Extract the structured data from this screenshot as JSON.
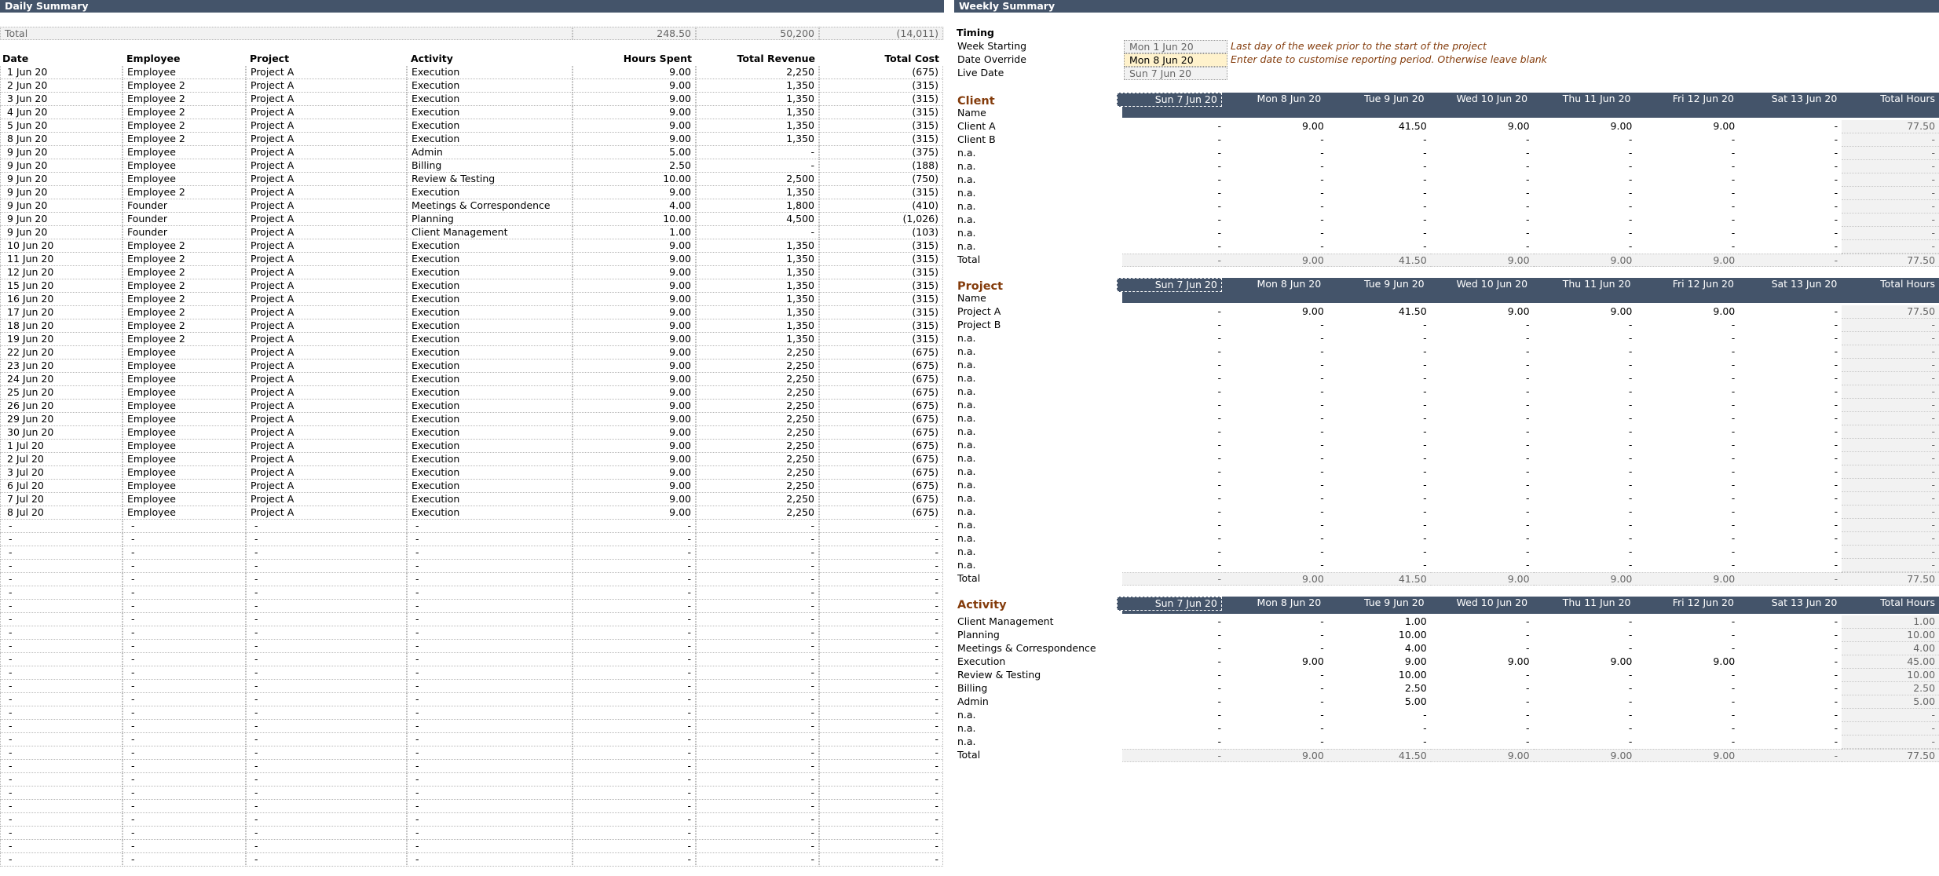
{
  "daily": {
    "title": "Daily Summary",
    "total": {
      "label": "Total",
      "hours": "248.50",
      "revenue": "50,200",
      "cost": "(14,011)"
    },
    "headers": [
      "Date",
      "Employee",
      "Project",
      "Activity",
      "Hours Spent",
      "Total Revenue",
      "Total Cost"
    ],
    "rows": [
      [
        "1 Jun 20",
        "Employee",
        "Project A",
        "Execution",
        "9.00",
        "2,250",
        "(675)"
      ],
      [
        "2 Jun 20",
        "Employee 2",
        "Project A",
        "Execution",
        "9.00",
        "1,350",
        "(315)"
      ],
      [
        "3 Jun 20",
        "Employee 2",
        "Project A",
        "Execution",
        "9.00",
        "1,350",
        "(315)"
      ],
      [
        "4 Jun 20",
        "Employee 2",
        "Project A",
        "Execution",
        "9.00",
        "1,350",
        "(315)"
      ],
      [
        "5 Jun 20",
        "Employee 2",
        "Project A",
        "Execution",
        "9.00",
        "1,350",
        "(315)"
      ],
      [
        "8 Jun 20",
        "Employee 2",
        "Project A",
        "Execution",
        "9.00",
        "1,350",
        "(315)"
      ],
      [
        "9 Jun 20",
        "Employee",
        "Project A",
        "Admin",
        "5.00",
        "-",
        "(375)"
      ],
      [
        "9 Jun 20",
        "Employee",
        "Project A",
        "Billing",
        "2.50",
        "-",
        "(188)"
      ],
      [
        "9 Jun 20",
        "Employee",
        "Project A",
        "Review & Testing",
        "10.00",
        "2,500",
        "(750)"
      ],
      [
        "9 Jun 20",
        "Employee 2",
        "Project A",
        "Execution",
        "9.00",
        "1,350",
        "(315)"
      ],
      [
        "9 Jun 20",
        "Founder",
        "Project A",
        "Meetings & Correspondence",
        "4.00",
        "1,800",
        "(410)"
      ],
      [
        "9 Jun 20",
        "Founder",
        "Project A",
        "Planning",
        "10.00",
        "4,500",
        "(1,026)"
      ],
      [
        "9 Jun 20",
        "Founder",
        "Project A",
        "Client Management",
        "1.00",
        "-",
        "(103)"
      ],
      [
        "10 Jun 20",
        "Employee 2",
        "Project A",
        "Execution",
        "9.00",
        "1,350",
        "(315)"
      ],
      [
        "11 Jun 20",
        "Employee 2",
        "Project A",
        "Execution",
        "9.00",
        "1,350",
        "(315)"
      ],
      [
        "12 Jun 20",
        "Employee 2",
        "Project A",
        "Execution",
        "9.00",
        "1,350",
        "(315)"
      ],
      [
        "15 Jun 20",
        "Employee 2",
        "Project A",
        "Execution",
        "9.00",
        "1,350",
        "(315)"
      ],
      [
        "16 Jun 20",
        "Employee 2",
        "Project A",
        "Execution",
        "9.00",
        "1,350",
        "(315)"
      ],
      [
        "17 Jun 20",
        "Employee 2",
        "Project A",
        "Execution",
        "9.00",
        "1,350",
        "(315)"
      ],
      [
        "18 Jun 20",
        "Employee 2",
        "Project A",
        "Execution",
        "9.00",
        "1,350",
        "(315)"
      ],
      [
        "19 Jun 20",
        "Employee 2",
        "Project A",
        "Execution",
        "9.00",
        "1,350",
        "(315)"
      ],
      [
        "22 Jun 20",
        "Employee",
        "Project A",
        "Execution",
        "9.00",
        "2,250",
        "(675)"
      ],
      [
        "23 Jun 20",
        "Employee",
        "Project A",
        "Execution",
        "9.00",
        "2,250",
        "(675)"
      ],
      [
        "24 Jun 20",
        "Employee",
        "Project A",
        "Execution",
        "9.00",
        "2,250",
        "(675)"
      ],
      [
        "25 Jun 20",
        "Employee",
        "Project A",
        "Execution",
        "9.00",
        "2,250",
        "(675)"
      ],
      [
        "26 Jun 20",
        "Employee",
        "Project A",
        "Execution",
        "9.00",
        "2,250",
        "(675)"
      ],
      [
        "29 Jun 20",
        "Employee",
        "Project A",
        "Execution",
        "9.00",
        "2,250",
        "(675)"
      ],
      [
        "30 Jun 20",
        "Employee",
        "Project A",
        "Execution",
        "9.00",
        "2,250",
        "(675)"
      ],
      [
        "1 Jul 20",
        "Employee",
        "Project A",
        "Execution",
        "9.00",
        "2,250",
        "(675)"
      ],
      [
        "2 Jul 20",
        "Employee",
        "Project A",
        "Execution",
        "9.00",
        "2,250",
        "(675)"
      ],
      [
        "3 Jul 20",
        "Employee",
        "Project A",
        "Execution",
        "9.00",
        "2,250",
        "(675)"
      ],
      [
        "6 Jul 20",
        "Employee",
        "Project A",
        "Execution",
        "9.00",
        "2,250",
        "(675)"
      ],
      [
        "7 Jul 20",
        "Employee",
        "Project A",
        "Execution",
        "9.00",
        "2,250",
        "(675)"
      ],
      [
        "8 Jul 20",
        "Employee",
        "Project A",
        "Execution",
        "9.00",
        "2,250",
        "(675)"
      ]
    ],
    "blank_row": [
      "-",
      "-",
      "-",
      "-",
      "-",
      "-",
      "-"
    ],
    "blank_count": 26
  },
  "weekly": {
    "title": "Weekly Summary",
    "timing": {
      "heading": "Timing",
      "fields": [
        {
          "label": "Week Starting",
          "value": "Mon 1 Jun 20",
          "note": "Last day of the week prior to the start of the project",
          "style": "grey"
        },
        {
          "label": "Date Override",
          "value": "Mon 8 Jun 20",
          "note": "Enter date to customise reporting period. Otherwise leave blank",
          "style": "yellow"
        },
        {
          "label": "Live Date",
          "value": "Sun 7 Jun 20",
          "note": "",
          "style": "grey"
        }
      ]
    },
    "day_headers": [
      "Sun 7 Jun 20",
      "Mon 8 Jun 20",
      "Tue 9 Jun 20",
      "Wed 10 Jun 20",
      "Thu 11 Jun 20",
      "Fri 12 Jun 20",
      "Sat 13 Jun 20",
      "Total Hours"
    ],
    "sections": [
      {
        "title": "Client",
        "sub_label": "Name",
        "rows": [
          [
            "Client A",
            "-",
            "9.00",
            "41.50",
            "9.00",
            "9.00",
            "9.00",
            "-",
            "77.50"
          ],
          [
            "Client B",
            "-",
            "-",
            "-",
            "-",
            "-",
            "-",
            "-",
            "-"
          ],
          [
            "n.a.",
            "-",
            "-",
            "-",
            "-",
            "-",
            "-",
            "-",
            "-"
          ],
          [
            "n.a.",
            "-",
            "-",
            "-",
            "-",
            "-",
            "-",
            "-",
            "-"
          ],
          [
            "n.a.",
            "-",
            "-",
            "-",
            "-",
            "-",
            "-",
            "-",
            "-"
          ],
          [
            "n.a.",
            "-",
            "-",
            "-",
            "-",
            "-",
            "-",
            "-",
            "-"
          ],
          [
            "n.a.",
            "-",
            "-",
            "-",
            "-",
            "-",
            "-",
            "-",
            "-"
          ],
          [
            "n.a.",
            "-",
            "-",
            "-",
            "-",
            "-",
            "-",
            "-",
            "-"
          ],
          [
            "n.a.",
            "-",
            "-",
            "-",
            "-",
            "-",
            "-",
            "-",
            "-"
          ],
          [
            "n.a.",
            "-",
            "-",
            "-",
            "-",
            "-",
            "-",
            "-",
            "-"
          ]
        ],
        "total": [
          "Total",
          "-",
          "9.00",
          "41.50",
          "9.00",
          "9.00",
          "9.00",
          "-",
          "77.50"
        ]
      },
      {
        "title": "Project",
        "sub_label": "Name",
        "rows": [
          [
            "Project A",
            "-",
            "9.00",
            "41.50",
            "9.00",
            "9.00",
            "9.00",
            "-",
            "77.50"
          ],
          [
            "Project B",
            "-",
            "-",
            "-",
            "-",
            "-",
            "-",
            "-",
            "-"
          ],
          [
            "n.a.",
            "-",
            "-",
            "-",
            "-",
            "-",
            "-",
            "-",
            "-"
          ],
          [
            "n.a.",
            "-",
            "-",
            "-",
            "-",
            "-",
            "-",
            "-",
            "-"
          ],
          [
            "n.a.",
            "-",
            "-",
            "-",
            "-",
            "-",
            "-",
            "-",
            "-"
          ],
          [
            "n.a.",
            "-",
            "-",
            "-",
            "-",
            "-",
            "-",
            "-",
            "-"
          ],
          [
            "n.a.",
            "-",
            "-",
            "-",
            "-",
            "-",
            "-",
            "-",
            "-"
          ],
          [
            "n.a.",
            "-",
            "-",
            "-",
            "-",
            "-",
            "-",
            "-",
            "-"
          ],
          [
            "n.a.",
            "-",
            "-",
            "-",
            "-",
            "-",
            "-",
            "-",
            "-"
          ],
          [
            "n.a.",
            "-",
            "-",
            "-",
            "-",
            "-",
            "-",
            "-",
            "-"
          ],
          [
            "n.a.",
            "-",
            "-",
            "-",
            "-",
            "-",
            "-",
            "-",
            "-"
          ],
          [
            "n.a.",
            "-",
            "-",
            "-",
            "-",
            "-",
            "-",
            "-",
            "-"
          ],
          [
            "n.a.",
            "-",
            "-",
            "-",
            "-",
            "-",
            "-",
            "-",
            "-"
          ],
          [
            "n.a.",
            "-",
            "-",
            "-",
            "-",
            "-",
            "-",
            "-",
            "-"
          ],
          [
            "n.a.",
            "-",
            "-",
            "-",
            "-",
            "-",
            "-",
            "-",
            "-"
          ],
          [
            "n.a.",
            "-",
            "-",
            "-",
            "-",
            "-",
            "-",
            "-",
            "-"
          ],
          [
            "n.a.",
            "-",
            "-",
            "-",
            "-",
            "-",
            "-",
            "-",
            "-"
          ],
          [
            "n.a.",
            "-",
            "-",
            "-",
            "-",
            "-",
            "-",
            "-",
            "-"
          ],
          [
            "n.a.",
            "-",
            "-",
            "-",
            "-",
            "-",
            "-",
            "-",
            "-"
          ],
          [
            "n.a.",
            "-",
            "-",
            "-",
            "-",
            "-",
            "-",
            "-",
            "-"
          ]
        ],
        "total": [
          "Total",
          "-",
          "9.00",
          "41.50",
          "9.00",
          "9.00",
          "9.00",
          "-",
          "77.50"
        ]
      },
      {
        "title": "Activity",
        "sub_label": "",
        "rows": [
          [
            "Client Management",
            "-",
            "-",
            "1.00",
            "-",
            "-",
            "-",
            "-",
            "1.00"
          ],
          [
            "Planning",
            "-",
            "-",
            "10.00",
            "-",
            "-",
            "-",
            "-",
            "10.00"
          ],
          [
            "Meetings & Correspondence",
            "-",
            "-",
            "4.00",
            "-",
            "-",
            "-",
            "-",
            "4.00"
          ],
          [
            "Execution",
            "-",
            "9.00",
            "9.00",
            "9.00",
            "9.00",
            "9.00",
            "-",
            "45.00"
          ],
          [
            "Review & Testing",
            "-",
            "-",
            "10.00",
            "-",
            "-",
            "-",
            "-",
            "10.00"
          ],
          [
            "Billing",
            "-",
            "-",
            "2.50",
            "-",
            "-",
            "-",
            "-",
            "2.50"
          ],
          [
            "Admin",
            "-",
            "-",
            "5.00",
            "-",
            "-",
            "-",
            "-",
            "5.00"
          ],
          [
            "n.a.",
            "-",
            "-",
            "-",
            "-",
            "-",
            "-",
            "-",
            "-"
          ],
          [
            "n.a.",
            "-",
            "-",
            "-",
            "-",
            "-",
            "-",
            "-",
            "-"
          ],
          [
            "n.a.",
            "-",
            "-",
            "-",
            "-",
            "-",
            "-",
            "-",
            "-"
          ]
        ],
        "total": [
          "Total",
          "-",
          "9.00",
          "41.50",
          "9.00",
          "9.00",
          "9.00",
          "-",
          "77.50"
        ]
      }
    ]
  }
}
